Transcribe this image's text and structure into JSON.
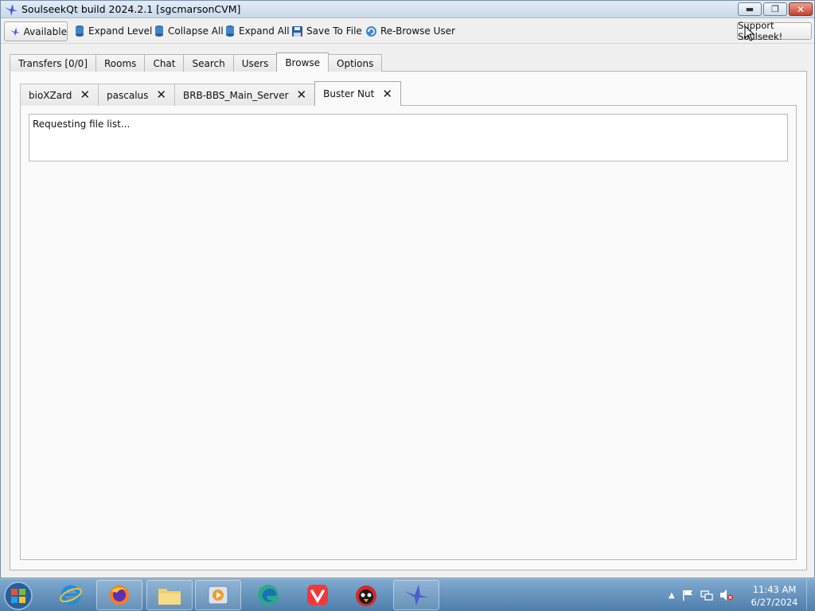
{
  "window": {
    "title": "SoulseekQt build 2024.2.1 [sgcmarsonCVM]"
  },
  "toolbar": {
    "status_label": "Available",
    "expand_level": "Expand Level",
    "collapse_all": "Collapse All",
    "expand_all": "Expand All",
    "save_to_file": "Save To File",
    "rebrowse_user": "Re-Browse User",
    "support": "Support Soulseek!"
  },
  "main_tabs": [
    {
      "label": "Transfers [0/0]",
      "active": false
    },
    {
      "label": "Rooms",
      "active": false
    },
    {
      "label": "Chat",
      "active": false
    },
    {
      "label": "Search",
      "active": false
    },
    {
      "label": "Users",
      "active": false
    },
    {
      "label": "Browse",
      "active": true
    },
    {
      "label": "Options",
      "active": false
    }
  ],
  "user_tabs": [
    {
      "label": "bioXZard",
      "active": false
    },
    {
      "label": "pascalus",
      "active": false
    },
    {
      "label": "BRB-BBS_Main_Server",
      "active": false
    },
    {
      "label": "Buster Nut",
      "active": true
    }
  ],
  "browse": {
    "status": "Requesting file list..."
  },
  "taskbar": {
    "apps": [
      "start-orb",
      "internet-explorer",
      "firefox",
      "windows-explorer",
      "media-player",
      "edge-chromium",
      "vivaldi",
      "angry-bird-app",
      "soulseek"
    ],
    "clock": {
      "time": "11:43 AM",
      "date": "6/27/2024"
    }
  },
  "colors": {
    "window_bg": "#f0f0f0",
    "taskbar": "#5b88b4",
    "close_button": "#c4412b"
  }
}
